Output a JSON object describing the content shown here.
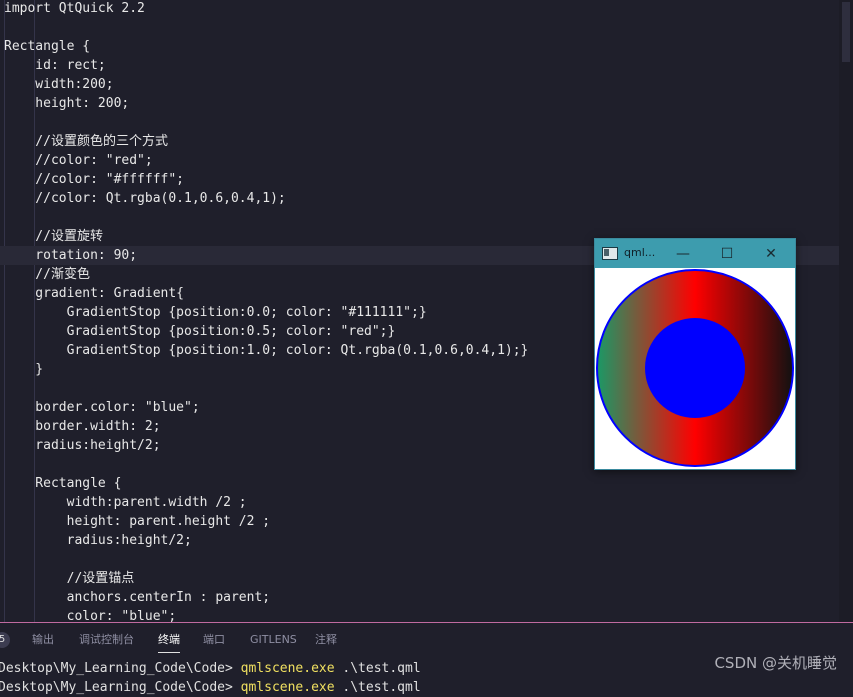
{
  "editor": {
    "lines": [
      {
        "text": "import QtQuick 2.2"
      },
      {
        "text": ""
      },
      {
        "text": "Rectangle {"
      },
      {
        "text": "    id: rect;"
      },
      {
        "text": "    width:200;"
      },
      {
        "text": "    height: 200;"
      },
      {
        "text": ""
      },
      {
        "text": "    //设置颜色的三个方式"
      },
      {
        "text": "    //color: \"red\";"
      },
      {
        "text": "    //color: \"#ffffff\";"
      },
      {
        "text": "    //color: Qt.rgba(0.1,0.6,0.4,1);"
      },
      {
        "text": ""
      },
      {
        "text": "    //设置旋转"
      },
      {
        "text": "    rotation: 90;",
        "current": true
      },
      {
        "text": "    //渐变色"
      },
      {
        "text": "    gradient: Gradient{"
      },
      {
        "text": "        GradientStop {position:0.0; color: \"#111111\";}"
      },
      {
        "text": "        GradientStop {position:0.5; color: \"red\";}"
      },
      {
        "text": "        GradientStop {position:1.0; color: Qt.rgba(0.1,0.6,0.4,1);}"
      },
      {
        "text": "    }"
      },
      {
        "text": ""
      },
      {
        "text": "    border.color: \"blue\";"
      },
      {
        "text": "    border.width: 2;"
      },
      {
        "text": "    radius:height/2;"
      },
      {
        "text": ""
      },
      {
        "text": "    Rectangle {"
      },
      {
        "text": "        width:parent.width /2 ;"
      },
      {
        "text": "        height: parent.height /2 ;"
      },
      {
        "text": "        radius:height/2;"
      },
      {
        "text": ""
      },
      {
        "text": "        //设置锚点"
      },
      {
        "text": "        anchors.centerIn : parent;"
      },
      {
        "text": "        color: \"blue\";"
      }
    ]
  },
  "panel": {
    "badge": "5",
    "tabs": [
      {
        "label": "输出"
      },
      {
        "label": "调试控制台"
      },
      {
        "label": "终端",
        "active": true
      },
      {
        "label": "端口"
      },
      {
        "label": "GITLENS"
      },
      {
        "label": "注释"
      }
    ],
    "terminal": {
      "line1_prefix": "Desktop\\My_Learning_Code\\Code> ",
      "line1_command": "qmlscene.exe",
      "line1_args": " .\\test.qml",
      "line2_prefix": "Desktop\\My_Learning_Code\\Code> ",
      "line2_command": "qmlscene.exe",
      "line2_args": " .\\test.qml"
    }
  },
  "watermark": "CSDN @关机睡觉",
  "qml_window": {
    "title": "qml...",
    "minimize_glyph": "—",
    "maximize_glyph": "☐",
    "close_glyph": "✕",
    "scene": {
      "outer_circle": {
        "gradient_stops": [
          {
            "position": 0.0,
            "color": "#111111"
          },
          {
            "position": 0.5,
            "color": "#ff0000"
          },
          {
            "position": 1.0,
            "color": "#1a9966"
          }
        ],
        "border_color": "#0000ff",
        "border_width": 2,
        "rotation": 90
      },
      "inner_circle": {
        "color": "#0000ff"
      }
    }
  }
}
